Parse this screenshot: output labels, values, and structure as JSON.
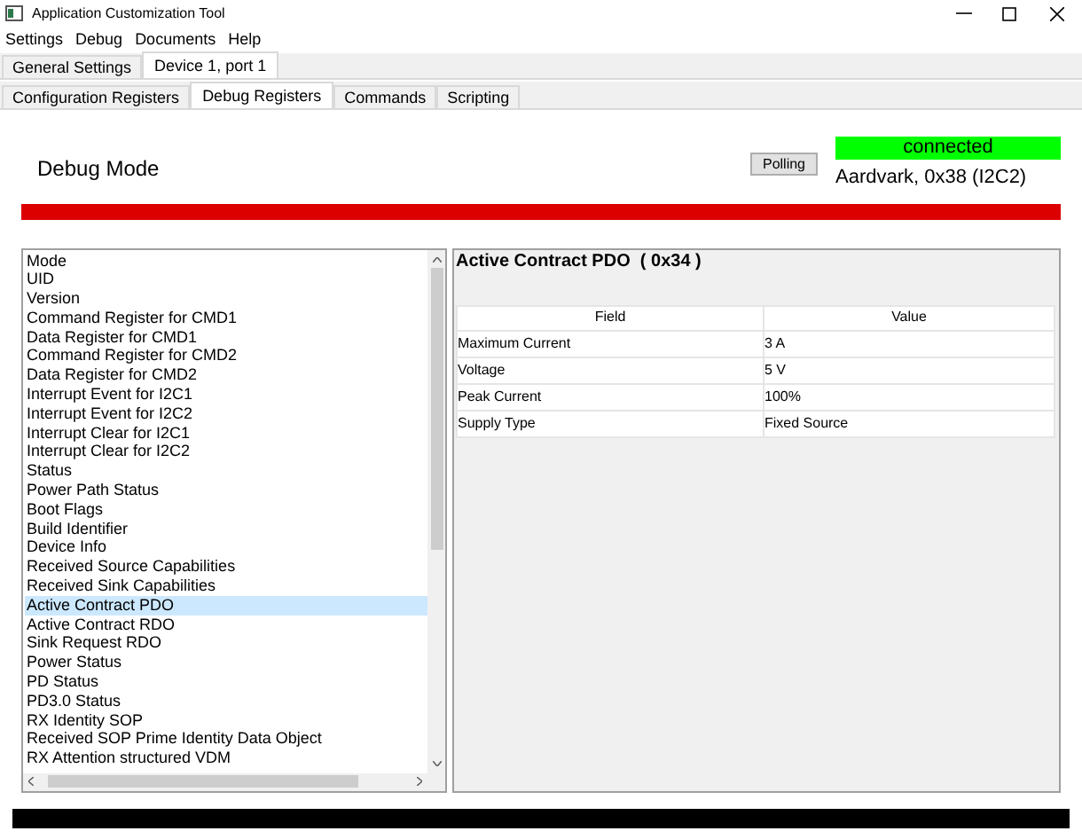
{
  "window": {
    "title": "Application Customization Tool"
  },
  "menu": [
    "Settings",
    "Debug",
    "Documents",
    "Help"
  ],
  "device_tabs": [
    {
      "label": "General Settings",
      "selected": false
    },
    {
      "label": "Device 1, port 1",
      "selected": true
    }
  ],
  "register_tabs": [
    {
      "label": "Configuration Registers",
      "selected": false
    },
    {
      "label": "Debug Registers",
      "selected": true
    },
    {
      "label": "Commands",
      "selected": false
    },
    {
      "label": "Scripting",
      "selected": false
    }
  ],
  "mode_title": "Debug Mode",
  "polling_button": "Polling",
  "connection": {
    "status": "connected",
    "connected": true,
    "adapter": "Aardvark, 0x38 (I2C2)"
  },
  "registers": [
    {
      "label": "Mode",
      "selected": false
    },
    {
      "label": "UID",
      "selected": false
    },
    {
      "label": "Version",
      "selected": false
    },
    {
      "label": "Command Register for CMD1",
      "selected": false
    },
    {
      "label": "Data Register for CMD1",
      "selected": false
    },
    {
      "label": "Command Register for CMD2",
      "selected": false
    },
    {
      "label": "Data Register for CMD2",
      "selected": false
    },
    {
      "label": "Interrupt Event for I2C1",
      "selected": false
    },
    {
      "label": "Interrupt Event for I2C2",
      "selected": false
    },
    {
      "label": "Interrupt Clear for I2C1",
      "selected": false
    },
    {
      "label": "Interrupt Clear for I2C2",
      "selected": false
    },
    {
      "label": "Status",
      "selected": false
    },
    {
      "label": "Power Path Status",
      "selected": false
    },
    {
      "label": "Boot Flags",
      "selected": false
    },
    {
      "label": "Build Identifier",
      "selected": false
    },
    {
      "label": "Device Info",
      "selected": false
    },
    {
      "label": "Received Source Capabilities",
      "selected": false
    },
    {
      "label": "Received Sink Capabilities",
      "selected": false
    },
    {
      "label": "Active Contract PDO",
      "selected": true
    },
    {
      "label": "Active Contract RDO",
      "selected": false
    },
    {
      "label": "Sink Request RDO",
      "selected": false
    },
    {
      "label": "Power Status",
      "selected": false
    },
    {
      "label": "PD Status",
      "selected": false
    },
    {
      "label": "PD3.0 Status",
      "selected": false
    },
    {
      "label": "RX Identity SOP",
      "selected": false
    },
    {
      "label": "Received SOP Prime Identity Data Object",
      "selected": false
    },
    {
      "label": "RX Attention structured VDM",
      "selected": false
    }
  ],
  "detail": {
    "title": "Active Contract PDO  ( 0x34 )",
    "columns": [
      "Field",
      "Value"
    ],
    "rows": [
      [
        "Maximum Current",
        "3 A"
      ],
      [
        "Voltage",
        "5 V"
      ],
      [
        "Peak Current",
        "100%"
      ],
      [
        "Supply Type",
        "Fixed Source"
      ]
    ]
  }
}
